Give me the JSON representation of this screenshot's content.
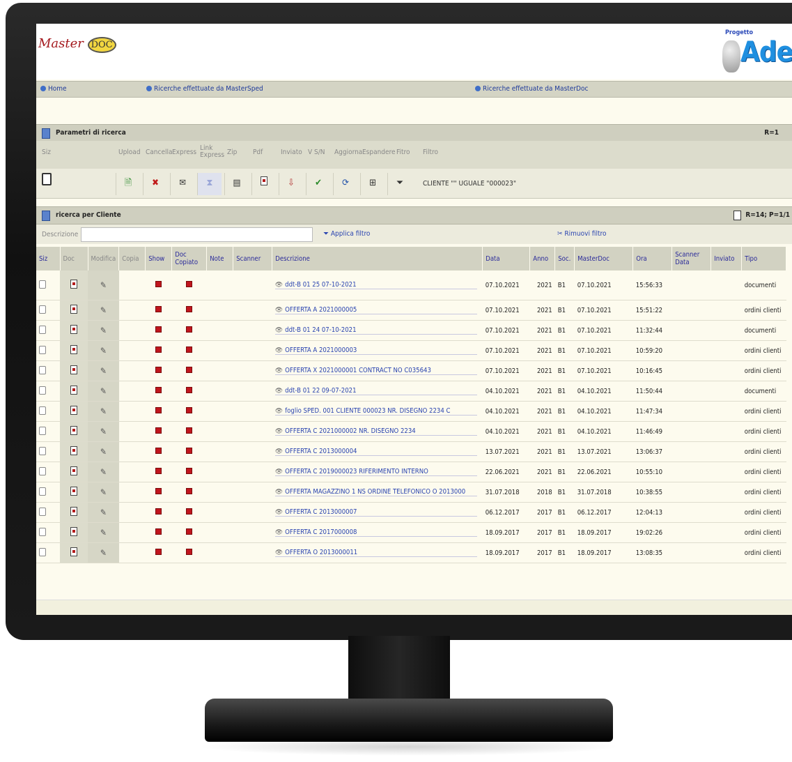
{
  "brand": {
    "left_logo_text": "Master",
    "left_logo_badge": "DOC",
    "right_logo_small": "Progetto",
    "right_logo_name": "Adele"
  },
  "nav": {
    "home": "Home",
    "masterSped": "Ricerche effettuate da MasterSped",
    "masterDoc": "Ricerche effettuate da MasterDoc"
  },
  "params": {
    "title": "Parametri di ricerca",
    "count": "R=1"
  },
  "toolbar": {
    "labels": {
      "siz": "Siz",
      "upload": "Upload",
      "cancella": "Cancella",
      "express": "Express",
      "link_express": "Link Express",
      "zip": "Zip",
      "pdf": "Pdf",
      "inviato": "Inviato",
      "vsn": "V S/N",
      "aggiorna": "Aggiorna",
      "espandere": "Espandere",
      "fitro": "Fitro",
      "filtro": "Filtro"
    },
    "filter_value": "CLIENTE \"\" UGUALE \"000023\""
  },
  "results": {
    "title": "ricerca per Cliente",
    "count": "R=14; P=1/1"
  },
  "search": {
    "label": "Descrizione",
    "value": "",
    "apply": "Applica filtro",
    "remove": "Rimuovi filtro"
  },
  "table": {
    "headers": {
      "siz": "Siz",
      "doc": "Doc",
      "modifica": "Modifica",
      "copia": "Copia",
      "show": "Show",
      "doc_copiato": "Doc Copiato",
      "note": "Note",
      "scanner": "Scanner",
      "descrizione": "Descrizione",
      "data": "Data",
      "anno": "Anno",
      "soc": "Soc.",
      "masterdoc": "MasterDoc",
      "ora": "Ora",
      "scanner_data": "Scanner Data",
      "inviato": "Inviato",
      "tipo": "Tipo"
    },
    "rows": [
      {
        "desc": "ddt-B 01 25 07-10-2021",
        "data": "07.10.2021",
        "anno": "2021",
        "soc": "B1",
        "masterdoc": "07.10.2021",
        "ora": "15:56:33",
        "tipo": "documenti"
      },
      {
        "desc": "OFFERTA A 2021000005",
        "data": "07.10.2021",
        "anno": "2021",
        "soc": "B1",
        "masterdoc": "07.10.2021",
        "ora": "15:51:22",
        "tipo": "ordini clienti"
      },
      {
        "desc": "ddt-B 01 24 07-10-2021",
        "data": "07.10.2021",
        "anno": "2021",
        "soc": "B1",
        "masterdoc": "07.10.2021",
        "ora": "11:32:44",
        "tipo": "documenti"
      },
      {
        "desc": "OFFERTA A 2021000003",
        "data": "07.10.2021",
        "anno": "2021",
        "soc": "B1",
        "masterdoc": "07.10.2021",
        "ora": "10:59:20",
        "tipo": "ordini clienti"
      },
      {
        "desc": "OFFERTA X 2021000001 CONTRACT NO C035643",
        "data": "07.10.2021",
        "anno": "2021",
        "soc": "B1",
        "masterdoc": "07.10.2021",
        "ora": "10:16:45",
        "tipo": "ordini clienti"
      },
      {
        "desc": "ddt-B 01 22 09-07-2021",
        "data": "04.10.2021",
        "anno": "2021",
        "soc": "B1",
        "masterdoc": "04.10.2021",
        "ora": "11:50:44",
        "tipo": "documenti"
      },
      {
        "desc": "foglio SPED. 001 CLIENTE 000023 NR. DISEGNO 2234 C",
        "data": "04.10.2021",
        "anno": "2021",
        "soc": "B1",
        "masterdoc": "04.10.2021",
        "ora": "11:47:34",
        "tipo": "ordini clienti"
      },
      {
        "desc": "OFFERTA C 2021000002 NR. DISEGNO 2234",
        "data": "04.10.2021",
        "anno": "2021",
        "soc": "B1",
        "masterdoc": "04.10.2021",
        "ora": "11:46:49",
        "tipo": "ordini clienti"
      },
      {
        "desc": "OFFERTA C 2013000004",
        "data": "13.07.2021",
        "anno": "2021",
        "soc": "B1",
        "masterdoc": "13.07.2021",
        "ora": "13:06:37",
        "tipo": "ordini clienti"
      },
      {
        "desc": "OFFERTA C 2019000023 RIFERIMENTO INTERNO",
        "data": "22.06.2021",
        "anno": "2021",
        "soc": "B1",
        "masterdoc": "22.06.2021",
        "ora": "10:55:10",
        "tipo": "ordini clienti"
      },
      {
        "desc": "OFFERTA MAGAZZINO 1 NS ORDINE TELEFONICO O 2013000",
        "data": "31.07.2018",
        "anno": "2018",
        "soc": "B1",
        "masterdoc": "31.07.2018",
        "ora": "10:38:55",
        "tipo": "ordini clienti"
      },
      {
        "desc": "OFFERTA C 2013000007",
        "data": "06.12.2017",
        "anno": "2017",
        "soc": "B1",
        "masterdoc": "06.12.2017",
        "ora": "12:04:13",
        "tipo": "ordini clienti"
      },
      {
        "desc": "OFFERTA C 2017000008",
        "data": "18.09.2017",
        "anno": "2017",
        "soc": "B1",
        "masterdoc": "18.09.2017",
        "ora": "19:02:26",
        "tipo": "ordini clienti"
      },
      {
        "desc": "OFFERTA O 2013000011",
        "data": "18.09.2017",
        "anno": "2017",
        "soc": "B1",
        "masterdoc": "18.09.2017",
        "ora": "13:08:35",
        "tipo": "ordini clienti"
      }
    ]
  }
}
